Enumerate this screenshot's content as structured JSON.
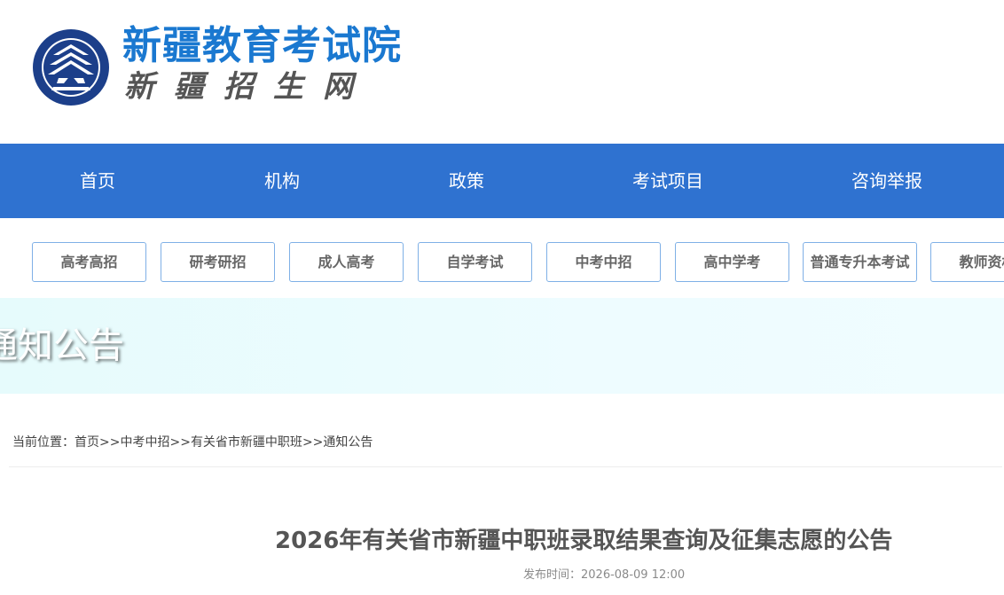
{
  "header": {
    "site_name": "新疆教育考试院",
    "site_sub": "新疆招生网",
    "emblem_caption": "新疆教育考试院"
  },
  "main_nav": {
    "items": [
      {
        "label": "首页"
      },
      {
        "label": "机构"
      },
      {
        "label": "政策"
      },
      {
        "label": "考试项目"
      },
      {
        "label": "咨询举报"
      }
    ]
  },
  "sub_nav": {
    "items": [
      {
        "label": "高考高招"
      },
      {
        "label": "研考研招"
      },
      {
        "label": "成人高考"
      },
      {
        "label": "自学考试"
      },
      {
        "label": "中考中招"
      },
      {
        "label": "高中学考"
      },
      {
        "label": "普通专升本考试"
      },
      {
        "label": "教师资格"
      }
    ]
  },
  "banner": {
    "title": "通知公告"
  },
  "breadcrumb": {
    "prefix": "当前位置：",
    "items": [
      {
        "label": "首页"
      },
      {
        "label": "中考中招"
      },
      {
        "label": "有关省市新疆中职班"
      },
      {
        "label": "通知公告"
      }
    ],
    "separator": ">>"
  },
  "article": {
    "title": "2026年有关省市新疆中职班录取结果查询及征集志愿的公告",
    "publish_label": "发布时间：",
    "publish_time": "2026-08-09 12:00"
  },
  "colors": {
    "nav_bg": "#2f72d0",
    "brand_blue": "#1a78d0",
    "button_border": "#7fb0e6",
    "banner_bg": "#e6fbfc",
    "emblem_navy": "#1c3f8a"
  }
}
